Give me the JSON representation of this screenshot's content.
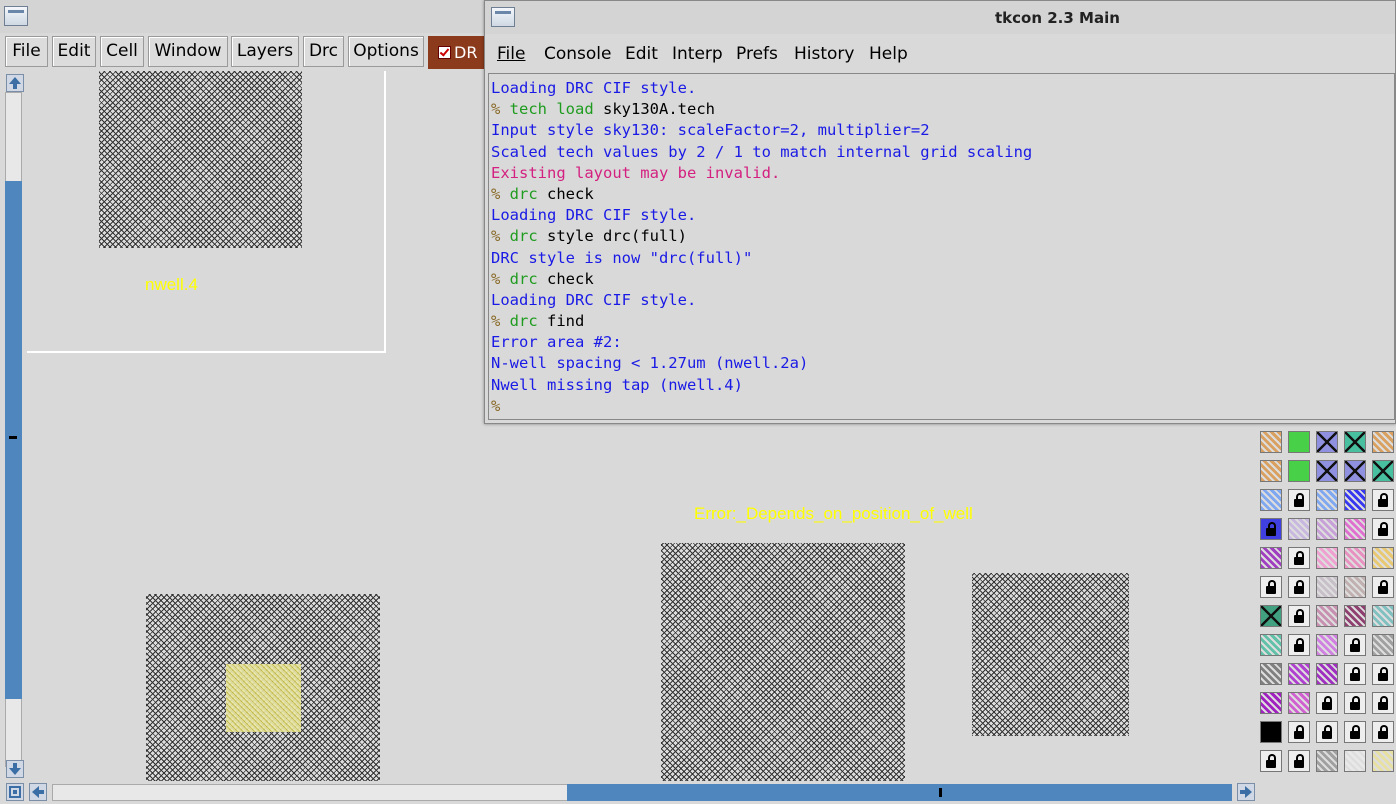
{
  "magic": {
    "menu": [
      "File",
      "Edit",
      "Cell",
      "Window",
      "Layers",
      "Drc",
      "Options"
    ],
    "drc_toggle_label": "DR",
    "canvas_labels": {
      "nwell": "nwell.4",
      "error": "Error:_Depends_on_position_of_well"
    }
  },
  "tkcon": {
    "title": "tkcon 2.3 Main",
    "menu": [
      "File",
      "Console",
      "Edit",
      "Interp",
      "Prefs",
      "History",
      "Help"
    ],
    "lines": [
      {
        "type": "output",
        "text": "Loading DRC CIF style."
      },
      {
        "type": "command",
        "prompt": "% ",
        "cmd": "tech load",
        "args": " sky130A.tech"
      },
      {
        "type": "output",
        "text": "Input style sky130: scaleFactor=2, multiplier=2"
      },
      {
        "type": "output",
        "text": "Scaled tech values by 2 / 1 to match internal grid scaling"
      },
      {
        "type": "error",
        "text": "Existing layout may be invalid."
      },
      {
        "type": "command",
        "prompt": "% ",
        "cmd": "drc",
        "args": " check"
      },
      {
        "type": "output",
        "text": "Loading DRC CIF style."
      },
      {
        "type": "command",
        "prompt": "% ",
        "cmd": "drc",
        "args": " style drc(full)"
      },
      {
        "type": "output",
        "text": "DRC style is now \"drc(full)\""
      },
      {
        "type": "command",
        "prompt": "% ",
        "cmd": "drc",
        "args": " check"
      },
      {
        "type": "output",
        "text": "Loading DRC CIF style."
      },
      {
        "type": "command",
        "prompt": "% ",
        "cmd": "drc",
        "args": " find"
      },
      {
        "type": "output",
        "text": "Error area #2:"
      },
      {
        "type": "output",
        "text": "N-well spacing < 1.27um (nwell.2a)"
      },
      {
        "type": "output",
        "text": "Nwell missing tap (nwell.4)"
      },
      {
        "type": "prompt",
        "text": "%"
      }
    ]
  },
  "colors": {
    "output": "#1a1ae6",
    "command": "#1f9c1f",
    "error": "#d42080",
    "scrollbar": "#4f86bd",
    "label": "#ffff00",
    "drc_button": "#8b3a1c"
  }
}
